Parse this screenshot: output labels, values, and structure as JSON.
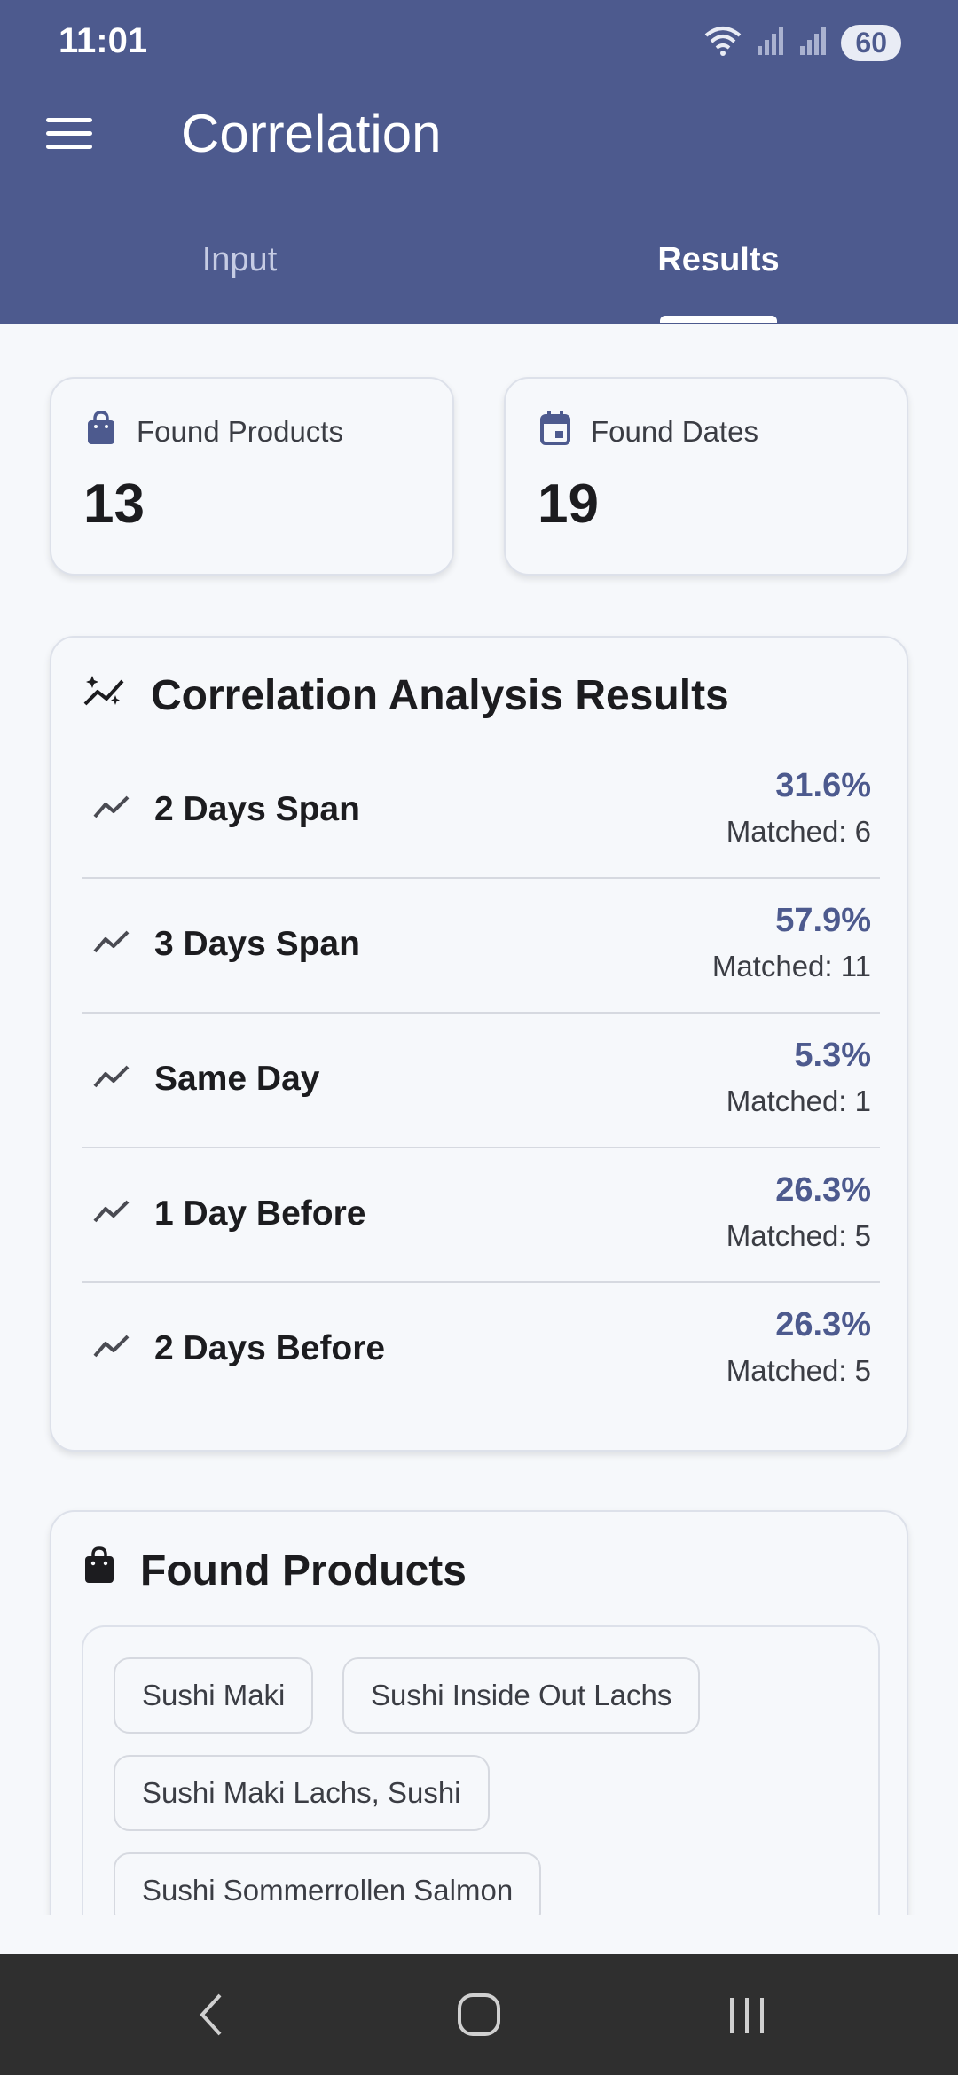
{
  "status_bar": {
    "time": "11:01",
    "battery": "60"
  },
  "app": {
    "title": "Correlation"
  },
  "tabs": [
    {
      "label": "Input",
      "active": false
    },
    {
      "label": "Results",
      "active": true
    }
  ],
  "stats": [
    {
      "label": "Found Products",
      "value": "13",
      "icon": "shopping-bag-icon"
    },
    {
      "label": "Found Dates",
      "value": "19",
      "icon": "calendar-icon"
    }
  ],
  "analysis": {
    "title": "Correlation Analysis Results",
    "rows": [
      {
        "label": "2 Days Span",
        "percent": "31.6%",
        "matched": "Matched: 6"
      },
      {
        "label": "3 Days Span",
        "percent": "57.9%",
        "matched": "Matched: 11"
      },
      {
        "label": "Same Day",
        "percent": "5.3%",
        "matched": "Matched: 1"
      },
      {
        "label": "1 Day Before",
        "percent": "26.3%",
        "matched": "Matched: 5"
      },
      {
        "label": "2 Days Before",
        "percent": "26.3%",
        "matched": "Matched: 5"
      }
    ]
  },
  "products": {
    "title": "Found Products",
    "items": [
      "Sushi Maki",
      "Sushi Inside Out Lachs",
      "Sushi Maki Lachs, Sushi",
      "Sushi Sommerrollen Salmon"
    ]
  },
  "colors": {
    "primary": "#4d5a8e",
    "background": "#f6f8fb",
    "navbar": "#2f2f2f"
  }
}
